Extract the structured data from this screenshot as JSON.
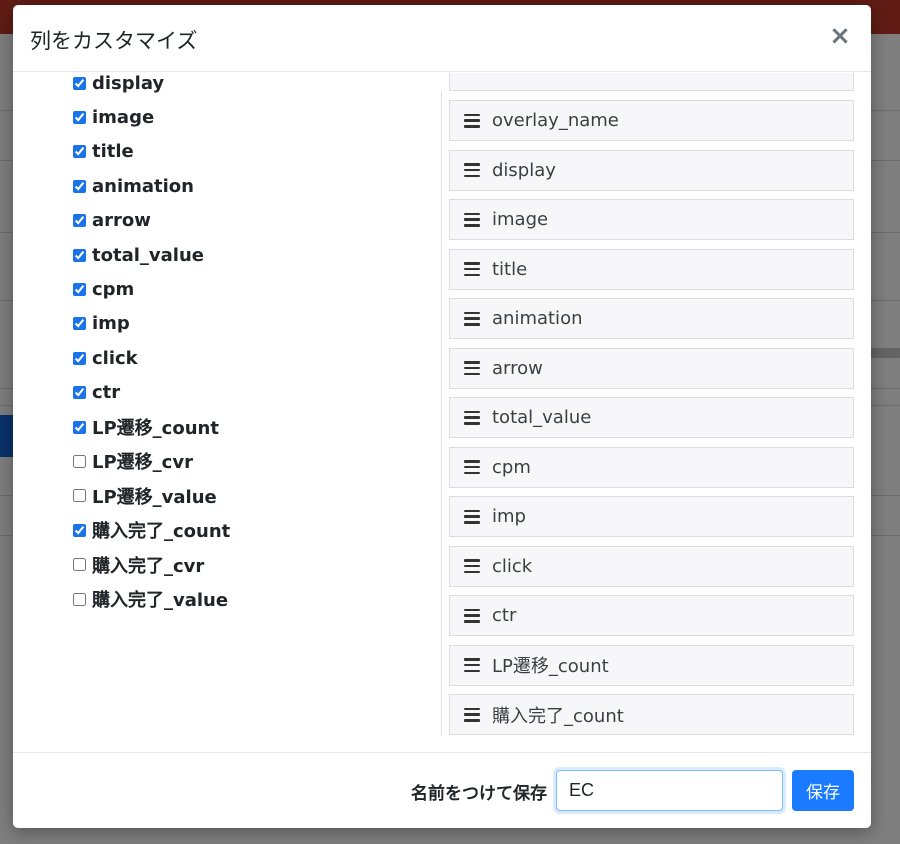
{
  "modal": {
    "title": "列をカスタマイズ",
    "close_label": "×"
  },
  "left_columns": [
    {
      "label": "display",
      "checked": true
    },
    {
      "label": "image",
      "checked": true
    },
    {
      "label": "title",
      "checked": true
    },
    {
      "label": "animation",
      "checked": true
    },
    {
      "label": "arrow",
      "checked": true
    },
    {
      "label": "total_value",
      "checked": true
    },
    {
      "label": "cpm",
      "checked": true
    },
    {
      "label": "imp",
      "checked": true
    },
    {
      "label": "click",
      "checked": true
    },
    {
      "label": "ctr",
      "checked": true
    },
    {
      "label": "LP遷移_count",
      "checked": true
    },
    {
      "label": "LP遷移_cvr",
      "checked": false
    },
    {
      "label": "LP遷移_value",
      "checked": false
    },
    {
      "label": "購入完了_count",
      "checked": true
    },
    {
      "label": "購入完了_cvr",
      "checked": false
    },
    {
      "label": "購入完了_value",
      "checked": false
    }
  ],
  "sorted_columns": [
    "overlay_name",
    "display",
    "image",
    "title",
    "animation",
    "arrow",
    "total_value",
    "cpm",
    "imp",
    "click",
    "ctr",
    "LP遷移_count",
    "購入完了_count"
  ],
  "footer": {
    "save_name_label": "名前をつけて保存",
    "name_value": "EC",
    "save_button": "保存"
  },
  "colors": {
    "primary": "#1a7bff",
    "checkbox": "#1a73e8",
    "item_bg": "#f7f7f9"
  }
}
